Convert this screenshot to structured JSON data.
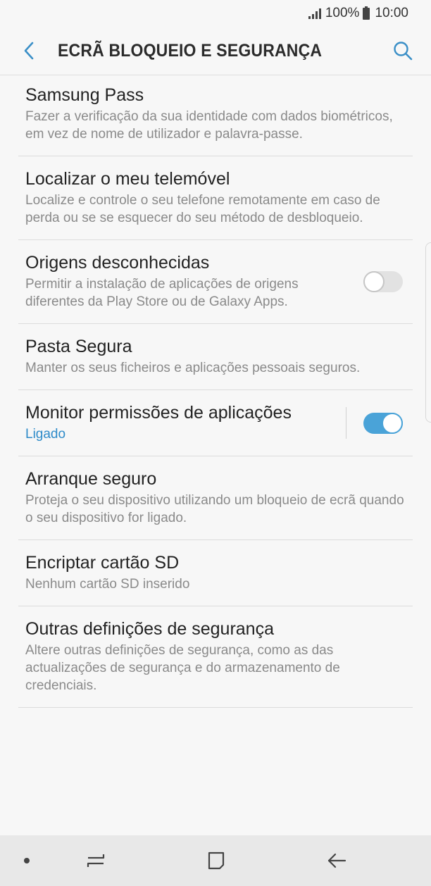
{
  "status_bar": {
    "battery": "100%",
    "time": "10:00"
  },
  "header": {
    "title": "ECRÃ BLOQUEIO E SEGURANÇA"
  },
  "items": [
    {
      "title": "Samsung Pass",
      "summary": "Fazer a verificação da sua identidade com dados biométricos, em vez de nome de utilizador e palavra-passe."
    },
    {
      "title": "Localizar o meu telemóvel",
      "summary": "Localize e controle o seu telefone remotamente em caso de perda ou se se esquecer do seu método de desbloqueio."
    },
    {
      "title": "Origens desconhecidas",
      "summary": "Permitir a instalação de aplicações de origens diferentes da Play Store ou de Galaxy Apps.",
      "toggle": "off"
    },
    {
      "title": "Pasta Segura",
      "summary": "Manter os seus ficheiros e aplicações pessoais seguros."
    },
    {
      "title": "Monitor permissões de aplicações",
      "summary": "Ligado",
      "toggle": "on"
    },
    {
      "title": "Arranque seguro",
      "summary": "Proteja o seu dispositivo utilizando um bloqueio de ecrã quando o seu dispositivo for ligado."
    },
    {
      "title": "Encriptar cartão SD",
      "summary": "Nenhum cartão SD inserido"
    },
    {
      "title": "Outras definições de segurança",
      "summary": "Altere outras definições de segurança, como as das actualizações de segurança e do armazenamento de credenciais."
    }
  ],
  "colors": {
    "accent": "#2e8bc9",
    "toggle_on": "#4aa3d8",
    "background": "#f7f7f7",
    "nav_bar": "#e8e8e8"
  },
  "icons": {
    "back": "chevron-left-icon",
    "search": "search-icon",
    "recents": "recents-icon",
    "home": "home-icon",
    "nav_back": "back-arrow-icon"
  }
}
